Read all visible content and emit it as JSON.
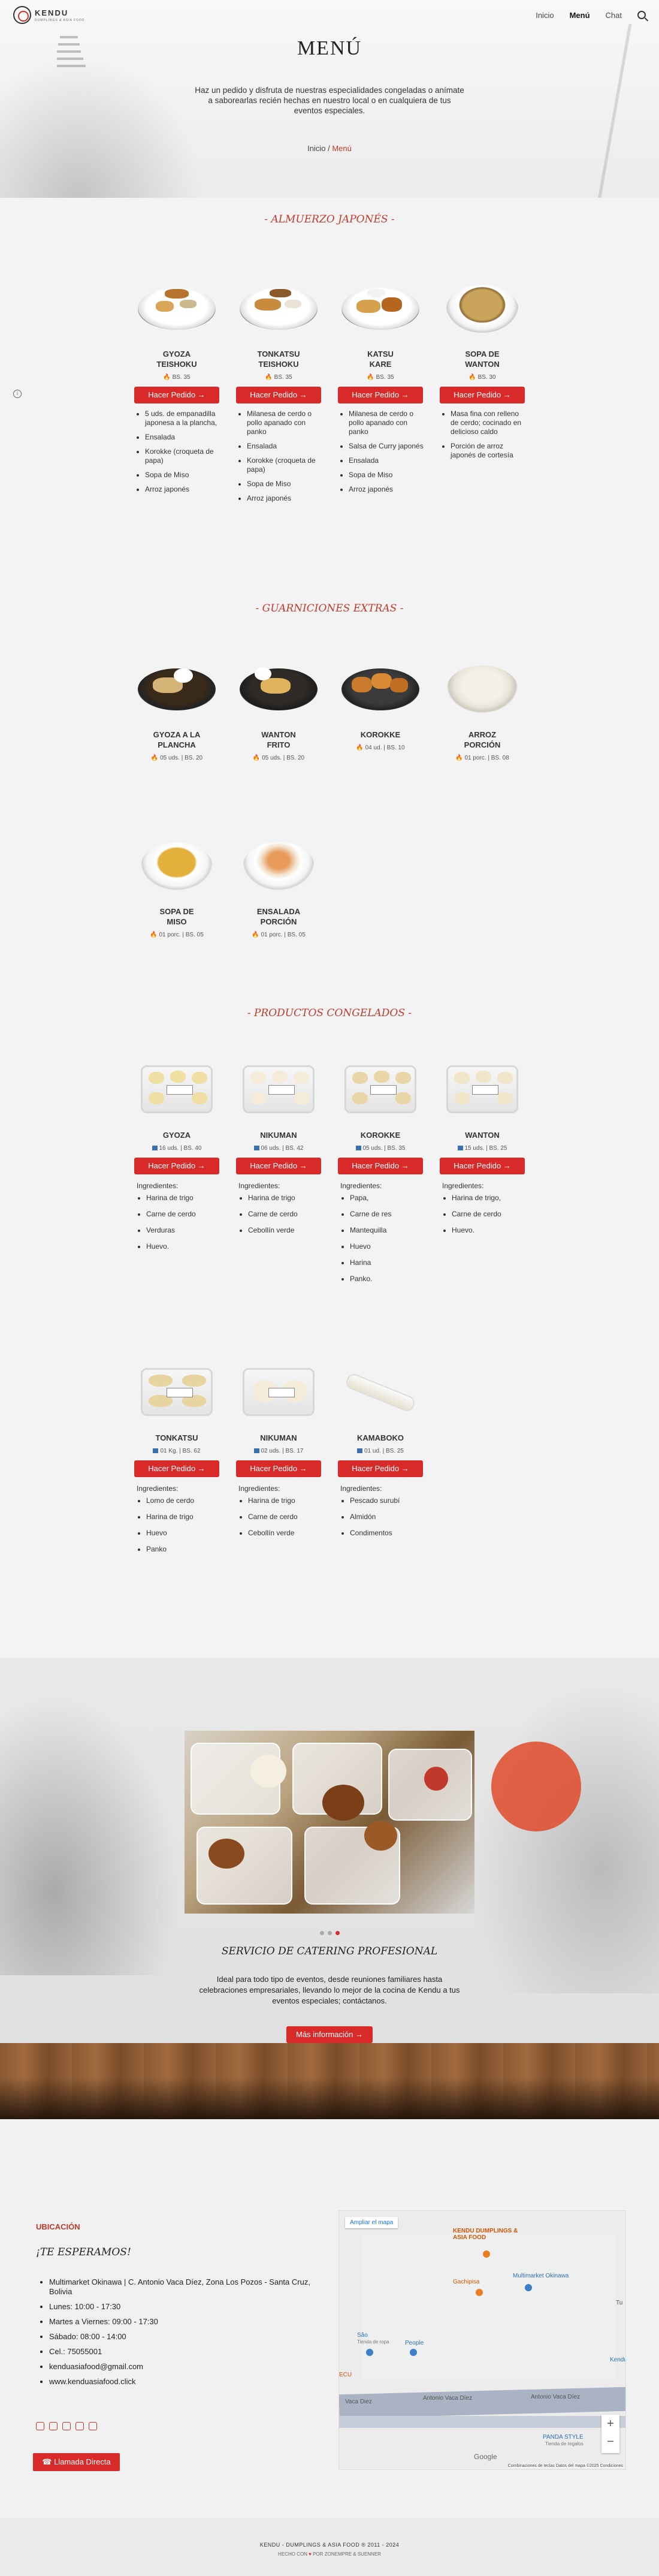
{
  "brand": {
    "name": "KENDU",
    "tagline": "DUMPLINGS & ASIA FOOD"
  },
  "nav": [
    {
      "label": "Inicio"
    },
    {
      "label": "Menú"
    },
    {
      "label": "Chat"
    }
  ],
  "hero": {
    "title": "MENÚ",
    "text": "Haz un pedido y disfruta de nuestras especialidades congeladas o anímate a saborearlas recién hechas en nuestro local o en cualquiera de tus eventos especiales.",
    "breadcrumb_home": "Inicio",
    "breadcrumb_sep": " / ",
    "breadcrumb_current": "Menú"
  },
  "order_button": "Hacer Pedido →",
  "ingredients_label": "Ingredientes:",
  "sections": {
    "almuerzo": "- ALMUERZO JAPONÉS -",
    "guarniciones": "- GUARNICIONES EXTRAS -",
    "congelados": "- PRODUCTOS CONGELADOS -"
  },
  "almuerzo": [
    {
      "name_l1": "GYOZA",
      "name_l2": "TEISHOKU",
      "price": "BS. 35",
      "items": [
        "5 uds. de empanadilla japonesa a la plancha,",
        "Ensalada",
        "Korokke (croqueta de papa)",
        "Sopa de Miso",
        "Arroz japonés"
      ]
    },
    {
      "name_l1": "TONKATSU",
      "name_l2": "TEISHOKU",
      "price": "BS. 35",
      "items": [
        "Milanesa de cerdo o pollo apanado con panko",
        "Ensalada",
        "Korokke (croqueta de papa)",
        "Sopa de Miso",
        "Arroz japonés"
      ]
    },
    {
      "name_l1": "KATSU",
      "name_l2": "KARE",
      "price": "BS. 35",
      "items": [
        "Milanesa de cerdo o pollo apanado con panko",
        "Salsa de Curry japonés",
        "Ensalada",
        "Sopa de Miso",
        "Arroz japonés"
      ]
    },
    {
      "name_l1": "SOPA DE",
      "name_l2": "WANTON",
      "price": "BS. 30",
      "items": [
        "Masa fina con relleno de cerdo; cocinado en delicioso caldo",
        "Porción de arroz japonés de cortesía"
      ]
    }
  ],
  "guarniciones": [
    {
      "name_l1": "GYOZA A LA",
      "name_l2": "PLANCHA",
      "qty": "05 uds.",
      "price": "BS. 20"
    },
    {
      "name_l1": "WANTON",
      "name_l2": "FRITO",
      "qty": "05 uds.",
      "price": "BS. 20"
    },
    {
      "name_l1": "KOROKKE",
      "name_l2": "",
      "qty": "04 ud.",
      "price": "BS. 10"
    },
    {
      "name_l1": "ARROZ",
      "name_l2": "PORCIÓN",
      "qty": "01 porc.",
      "price": "BS. 08"
    },
    {
      "name_l1": "SOPA DE",
      "name_l2": "MISO",
      "qty": "01 porc.",
      "price": "BS. 05"
    },
    {
      "name_l1": "ENSALADA",
      "name_l2": "PORCIÓN",
      "qty": "01 porc.",
      "price": "BS. 05"
    }
  ],
  "congelados": [
    {
      "name": "GYOZA",
      "qty": "16 uds.",
      "price": "BS. 40",
      "items": [
        "Harina de trigo",
        "Carne de cerdo",
        "Verduras",
        "Huevo."
      ]
    },
    {
      "name": "NIKUMAN",
      "qty": "06 uds.",
      "price": "BS. 42",
      "items": [
        "Harina de trigo",
        "Carne de cerdo",
        "Cebollín verde"
      ]
    },
    {
      "name": "KOROKKE",
      "qty": "05 uds.",
      "price": "BS. 35",
      "items": [
        "Papa,",
        "Carne de res",
        "Mantequilla",
        "Huevo",
        "Harina",
        "Panko."
      ]
    },
    {
      "name": "WANTON",
      "qty": "15 uds.",
      "price": "BS. 25",
      "items": [
        "Harina de trigo,",
        "Carne de cerdo",
        "Huevo."
      ]
    },
    {
      "name": "TONKATSU",
      "qty": "01 Kg.",
      "price": "BS. 62",
      "items": [
        "Lomo de cerdo",
        "Harina de trigo",
        "Huevo",
        "Panko"
      ]
    },
    {
      "name": "NIKUMAN",
      "qty": "02 uds.",
      "price": "BS. 17",
      "items": [
        "Harina de trigo",
        "Carne de cerdo",
        "Cebollín verde"
      ]
    },
    {
      "name": "KAMABOKO",
      "qty": "01 ud.",
      "price": "BS. 25",
      "items": [
        "Pescado surubí",
        "Almidón",
        "Condimentos"
      ]
    }
  ],
  "catering": {
    "title": "SERVICIO DE CATERING PROFESIONAL",
    "text": "Ideal para todo tipo de eventos, desde reuniones familiares hasta celebraciones empresariales, llevando lo mejor de la cocina de Kendu a tus eventos especiales; contáctanos.",
    "button": "Más información →"
  },
  "footer": {
    "location_label": "UBICACIÓN",
    "heading": "¡TE ESPERAMOS!",
    "items": [
      "Multimarket Okinawa | C. Antonio Vaca Díez, Zona Los Pozos - Santa Cruz, Bolivia",
      "Lunes: 10:00 - 17:30",
      "Martes a Viernes: 09:00 - 17:30",
      "Sábado: 08:00 - 14:00",
      "Cel.: 75055001",
      "kenduasiafood@gmail.com",
      "www.kenduasiafood.click"
    ],
    "call_button": "☎ Llamada Directa",
    "copyright": "KENDU - DUMPLINGS & ASIA FOOD ® 2011 - 2024",
    "made_prefix": "HECHO CON",
    "made_suffix": "POR ZONEMPRE & SUENNER"
  },
  "map": {
    "expand": "Ampliar el mapa",
    "place": "KENDU DUMPLINGS & ASIA FOOD",
    "gachipisa": "Gachipisa",
    "multimarket": "Multimarket Okinawa",
    "sao": "São",
    "sao_sub": "Tienda de ropa",
    "people": "People",
    "ecu": "ECU",
    "road1": "Vaca Diez",
    "road2": "Antonio Vaca Díez",
    "panda": "PANDA STYLE",
    "panda_sub": "Tienda de regalos",
    "kendu_short": "Kendu",
    "tu": "Tu",
    "google": "Google",
    "attribution": "Combinaciones de teclas   Datos del mapa ©2025   Condiciones"
  }
}
